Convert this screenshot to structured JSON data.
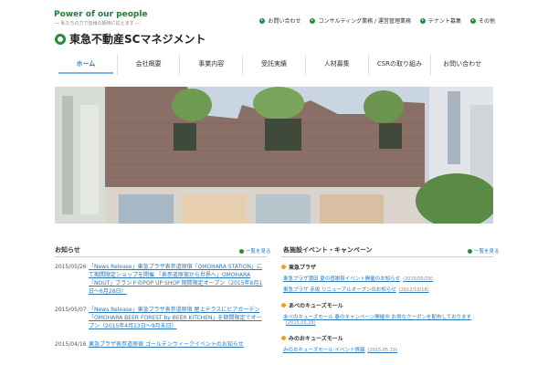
{
  "header": {
    "tagline": "Power of our people",
    "subtagline": "― 私たちの力で皆様の期待に応えます ―",
    "logo_text": "東急不動産SCマネジメント",
    "util_links": [
      {
        "label": "お問い合わせ",
        "icon": "arrow-circle-icon"
      },
      {
        "label": "コンサルティング業務 / 運営管理業務",
        "icon": "arrow-circle-icon"
      },
      {
        "label": "テナント募集",
        "icon": "arrow-circle-icon"
      },
      {
        "label": "その他",
        "icon": "arrow-circle-icon"
      }
    ]
  },
  "nav": {
    "tabs": [
      {
        "label": "ホーム",
        "active": true
      },
      {
        "label": "会社概要"
      },
      {
        "label": "事業内容"
      },
      {
        "label": "受託実績"
      },
      {
        "label": "人材募集"
      },
      {
        "label": "CSRの取り組み"
      },
      {
        "label": "お問い合わせ"
      }
    ]
  },
  "news": {
    "title": "お知らせ",
    "list_link": "一覧を見る",
    "items": [
      {
        "date": "2015/05/26",
        "text": "「News Release」東急プラザ表参道原宿「OMOHARA STATION」にて期間限定ショップを開催 「表参道原宿から世界へ」OMOHARA「NOUT」ブランドのPOP UP SHOP 期間限定オープン（2015年6月1日〜6月28日）"
      },
      {
        "date": "2015/05/07",
        "text": "「News Release」東急プラザ表参道原宿 屋上テラスにビアガーデン「OMOHARA BEER FOREST by BEER KITCHEN」を期間限定でオープン（2015年4月23日〜9月末日）"
      },
      {
        "date": "2015/04/16",
        "text": "東急プラザ表参道原宿 ゴールデンウィークイベントのお知らせ"
      }
    ]
  },
  "events": {
    "title": "各施設イベント・キャンペーン",
    "list_link": "一覧を見る",
    "groups": [
      {
        "name": "東急プラザ",
        "lines": [
          {
            "text": "東急プラザ蒲田 夏の感謝祭イベント開催のお知らせ",
            "date": "(2015/05/29)"
          },
          {
            "text": "東急プラザ 赤坂 リニューアルオープンのお知らせ",
            "date": "(2012/10/18)"
          }
        ]
      },
      {
        "name": "あべのキューズモール",
        "lines": [
          {
            "text": "あべのキューズモール 春のキャンペーン開催中 お得なクーポンを配布しております",
            "date": "(2015.05.29)"
          }
        ]
      },
      {
        "name": "みのおキューズモール",
        "lines": [
          {
            "text": "みのおキューズモール イベント情報",
            "date": "(2015.05.19)"
          }
        ]
      }
    ]
  },
  "colors": {
    "brand_green": "#2a8a3e",
    "link_blue": "#2a78b8",
    "nav_active_underline": "#7bb7e6",
    "event_dot": "#f0a020"
  }
}
